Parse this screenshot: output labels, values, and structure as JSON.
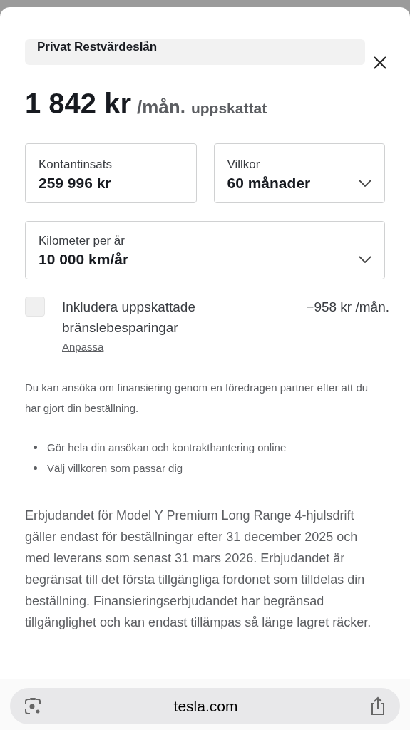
{
  "header": {
    "title": "Privat Restvärdeslån"
  },
  "price": {
    "amount": "1 842 kr",
    "unit": "/mån.",
    "note": "uppskattat"
  },
  "fields": [
    {
      "label": "Kontantinsats",
      "value": "259 996 kr",
      "kind": "input"
    },
    {
      "label": "Villkor",
      "value": "60 månader",
      "kind": "select"
    },
    {
      "label": "Kilometer per år",
      "value": "10 000 km/år",
      "kind": "select"
    }
  ],
  "fuel_savings": {
    "label": "Inkludera uppskattade bränslebesparingar",
    "amount": "−958 kr /mån.",
    "checked": false,
    "link": "Anpassa"
  },
  "intro": "Du kan ansöka om finansiering genom en föredragen partner efter att du har gjort din beställning.",
  "bullets": [
    "Gör hela din ansökan och kontrakthantering online",
    "Välj villkoren som passar dig"
  ],
  "offer": "Erbjudandet för Model Y Premium Long Range 4-hjulsdrift gäller endast för beställningar efter 31 december 2025 och med leverans som senast 31 mars 2026. Erbjudandet är begränsat till det första tillgängliga fordonet som tilldelas din beställning. Finansieringserbjudandet har begränsad tillgänglighet och kan endast tillämpas så länge lagret räcker.",
  "browser": {
    "url": "tesla.com"
  }
}
